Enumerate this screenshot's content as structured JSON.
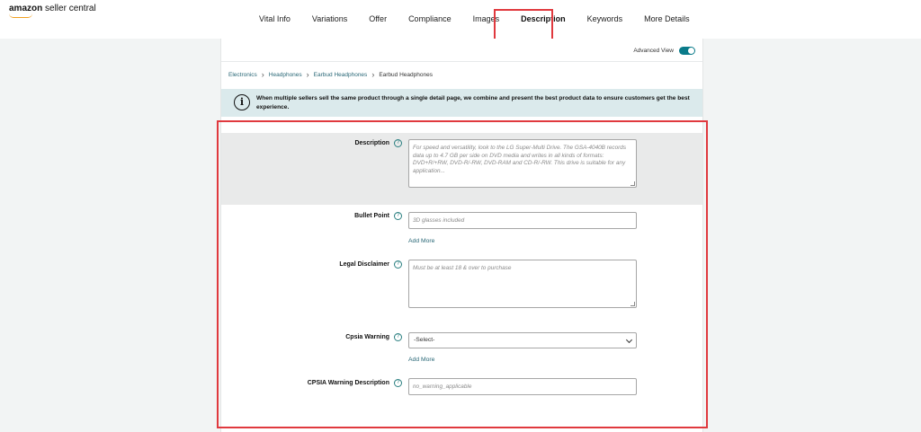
{
  "brand": {
    "name_bold": "amazon",
    "name_rest": " seller central",
    "accent_color": "#f0a020"
  },
  "tabs": [
    {
      "label": "Vital Info",
      "active": false
    },
    {
      "label": "Variations",
      "active": false
    },
    {
      "label": "Offer",
      "active": false
    },
    {
      "label": "Compliance",
      "active": false
    },
    {
      "label": "Images",
      "active": false
    },
    {
      "label": "Description",
      "active": true
    },
    {
      "label": "Keywords",
      "active": false
    },
    {
      "label": "More Details",
      "active": false
    }
  ],
  "advanced_view": {
    "label": "Advanced View",
    "enabled": true,
    "color": "#0a7b8a"
  },
  "breadcrumb": [
    "Electronics",
    "Headphones",
    "Earbud Headphones",
    "Earbud Headphones"
  ],
  "notice": {
    "icon": "info-icon",
    "text": "When multiple sellers sell the same product through a single detail page, we combine and present the best product data to ensure customers get the best experience."
  },
  "fields": {
    "description": {
      "label": "Description",
      "placeholder": "For speed and versatility, look to the LG Super-Multi Drive. The GSA-4040B records data up to 4.7 GB per side on DVD media and writes in all kinds of formats: DVD+R/+RW, DVD-R/-RW, DVD-RAM and CD-R/-RW. This drive is suitable for any application..."
    },
    "bullet_point": {
      "label": "Bullet Point",
      "placeholder": "3D glasses included",
      "add_more": "Add More"
    },
    "legal_disclaimer": {
      "label": "Legal Disclaimer",
      "placeholder": "Must be at least 18 & over to purchase"
    },
    "cpsia_warning": {
      "label": "Cpsia Warning",
      "selected": "-Select-",
      "add_more": "Add More"
    },
    "cpsia_warning_description": {
      "label": "CPSIA Warning Description",
      "placeholder": "no_warning_applicable"
    }
  },
  "colors": {
    "highlight": "#e0393e",
    "link": "#2a6877",
    "notice_bg": "#dbeaec"
  }
}
